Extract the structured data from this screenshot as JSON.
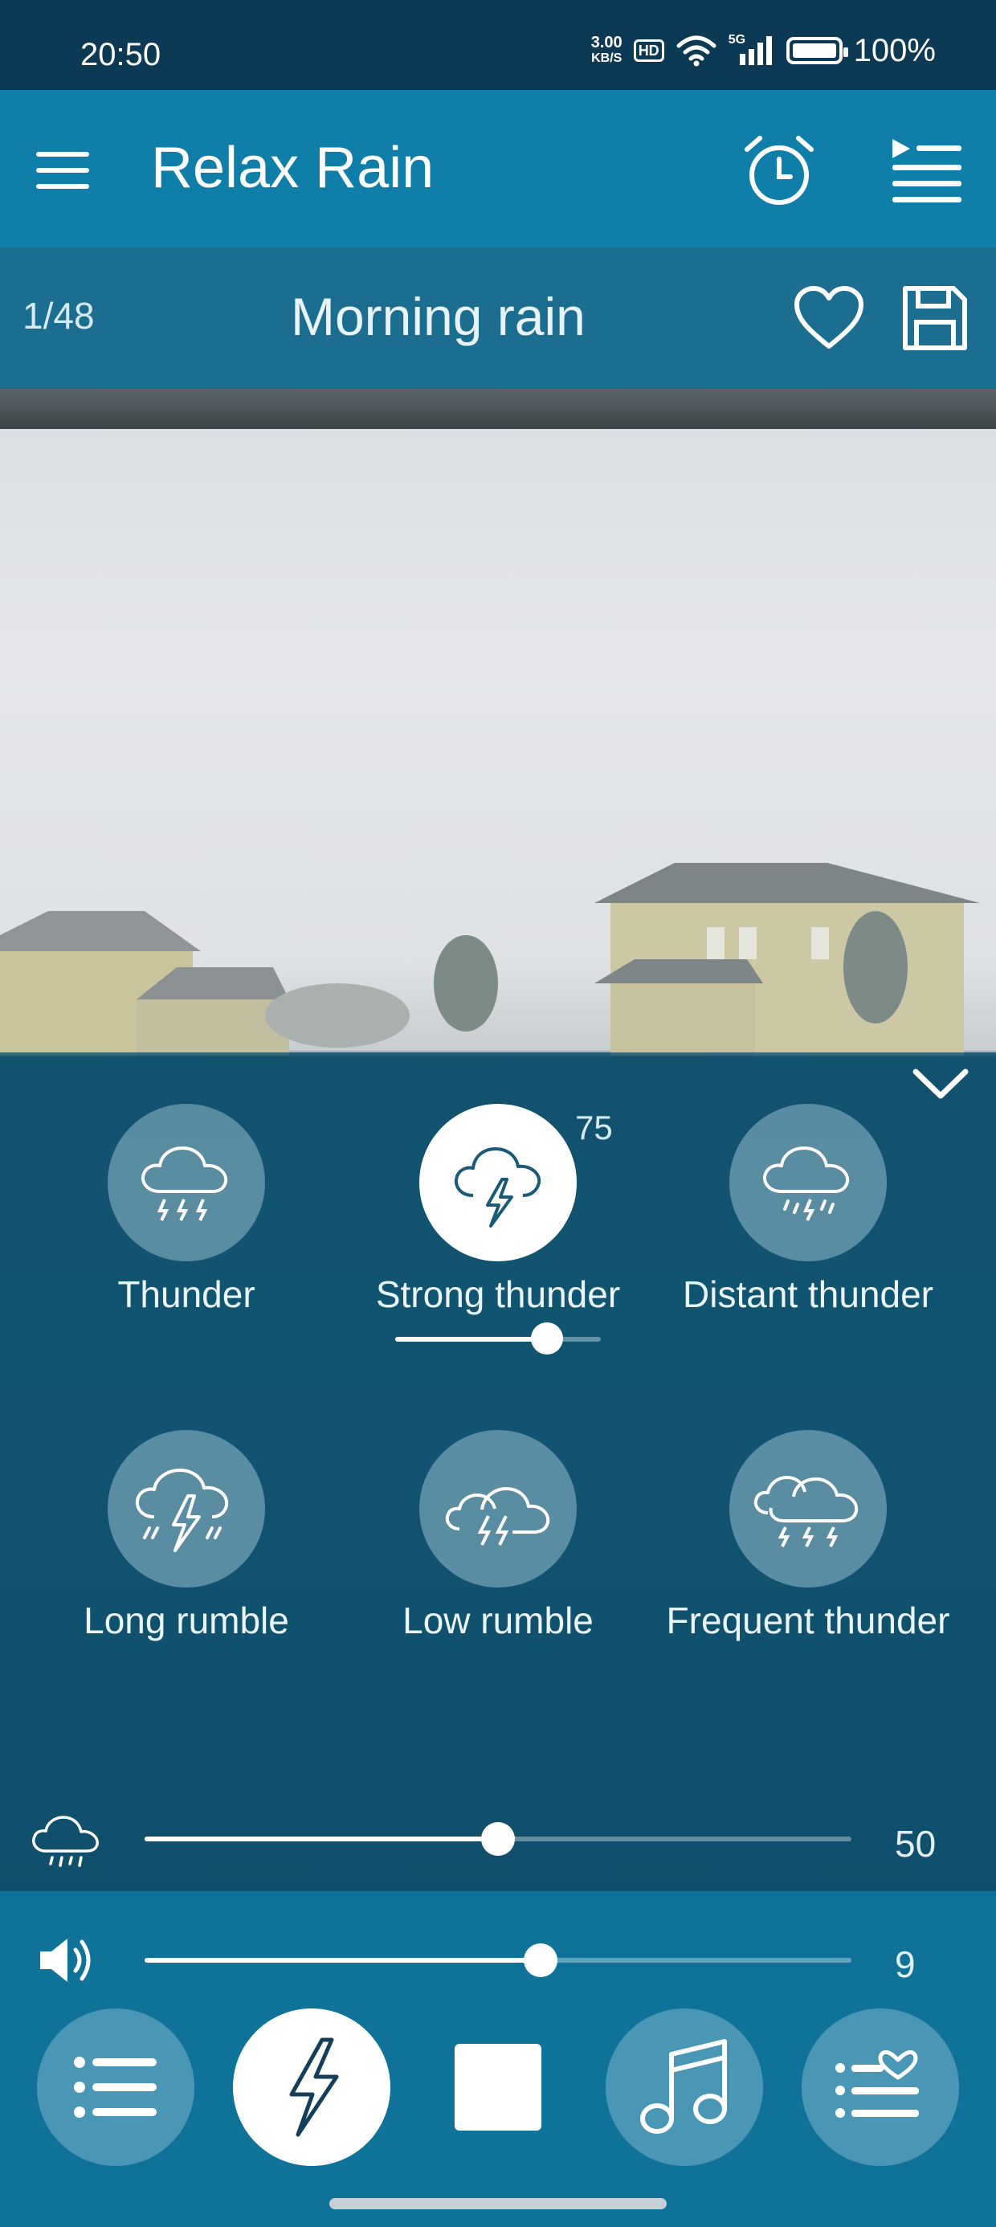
{
  "status_bar": {
    "time": "20:50",
    "net_speed_value": "3.00",
    "net_speed_unit": "KB/S",
    "hd": "HD",
    "signal_label": "5G",
    "battery": "100%"
  },
  "app_bar": {
    "title": "Relax Rain",
    "icons": [
      "menu-icon",
      "alarm-clock-icon",
      "playlist-icon"
    ]
  },
  "track": {
    "counter": "1/48",
    "name": "Morning rain"
  },
  "sound_tiles": [
    {
      "label": "Thunder",
      "icon": "cloud-thunder-icon",
      "active": false
    },
    {
      "label": "Strong thunder",
      "icon": "cloud-lightning-icon",
      "active": true,
      "volume": "75",
      "volume_fraction": 0.74
    },
    {
      "label": "Distant thunder",
      "icon": "cloud-rain-lightning-icon",
      "active": false
    },
    {
      "label": "Long rumble",
      "icon": "storm-cloud-icon",
      "active": false
    },
    {
      "label": "Low rumble",
      "icon": "double-cloud-lightning-icon",
      "active": false
    },
    {
      "label": "Frequent thunder",
      "icon": "clouds-thunder-icon",
      "active": false
    }
  ],
  "rain_slider": {
    "value": "50",
    "fraction": 0.5
  },
  "volume_slider": {
    "value": "9",
    "fraction": 0.56
  },
  "bottom_nav": {
    "items": [
      "list-icon",
      "thunder-icon",
      "stop-icon",
      "music-note-icon",
      "favorites-list-icon"
    ]
  }
}
